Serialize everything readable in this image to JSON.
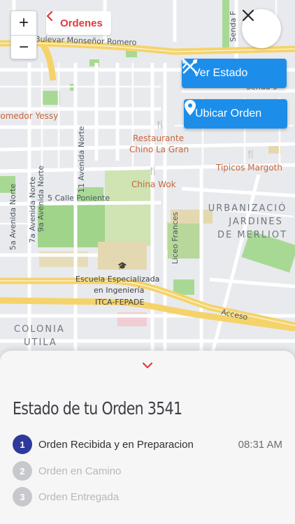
{
  "map": {
    "zoom_in": "+",
    "zoom_out": "−",
    "streets": {
      "bulevar": "Bulevar Monseñor Romero",
      "calle5": "5 Calle Poniente",
      "av11": "11 Avenida Norte",
      "av9": "9a Avenida Norte",
      "av7": "7a Avenida Norte",
      "av5": "5a Avenida Norte",
      "liceo": "Liceo Frances",
      "acceso": "Acceso",
      "senda_top": "Senda F",
      "senda_mid": "Senda 5",
      "senda_vert": "Senda F"
    },
    "pois": {
      "comedor": "Comedor Yessy",
      "chino_l1": "Restaurante",
      "chino_l2": "Chino La Gran",
      "margoth": "Tipicos Margoth",
      "chinawok": "China Wok",
      "itca_l1": "Escuela Especializada",
      "itca_l2": "en Ingeniería",
      "itca_l3": "ITCA-FEPADE"
    },
    "districts": {
      "urb_l1": "URBANIZACIÓ",
      "urb_l2": "JARDINES",
      "urb_l3": "DE MERLIOT",
      "col_l1": "COLONIA",
      "col_l2": "UTILA"
    }
  },
  "nav": {
    "back_label": "Ordenes",
    "close_icon": "close-icon"
  },
  "actions": {
    "ver_estado": "Ver Estado",
    "ubicar_orden": "Ubicar Orden"
  },
  "sheet": {
    "title": "Estado de tu Orden 3541",
    "steps": [
      {
        "num": "1",
        "label": "Orden Recibida y en Preparacion",
        "time": "08:31 AM",
        "active": true
      },
      {
        "num": "2",
        "label": "Orden en Camino",
        "time": "",
        "active": false
      },
      {
        "num": "3",
        "label": "Orden Entregada",
        "time": "",
        "active": false
      }
    ]
  },
  "colors": {
    "accent_red": "#e03a3e",
    "action_blue": "#1c8eea",
    "step_active": "#2d3a9c",
    "step_inactive": "#c7c8cc"
  }
}
